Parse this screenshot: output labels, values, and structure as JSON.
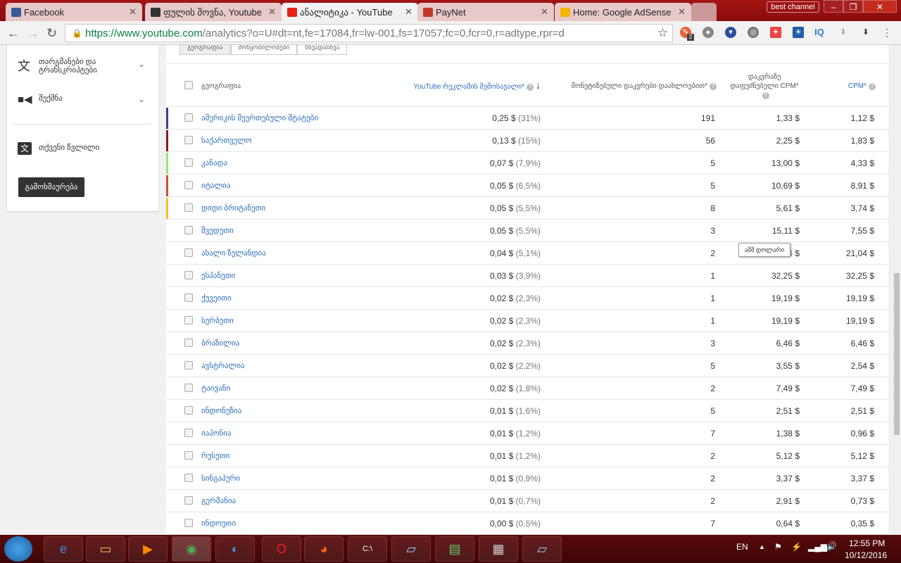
{
  "browser": {
    "tabs": [
      {
        "title": "Facebook",
        "icon": "facebook-icon",
        "color": "#3b5998"
      },
      {
        "title": "ფულის შოვნა, Youtube",
        "icon": "site-logo-icon",
        "color": "#333333"
      },
      {
        "title": "ანალიტიკა - YouTube",
        "icon": "youtube-icon",
        "color": "#e62117",
        "active": true
      },
      {
        "title": "PayNet",
        "icon": "paynet-icon",
        "color": "#c0392b"
      },
      {
        "title": "Home: Google AdSense",
        "icon": "adsense-icon",
        "color": "#f4b400"
      }
    ],
    "profile": "best channel",
    "url_host": "https://www.youtube.com",
    "url_path": "/analytics?o=U#dt=nt,fe=17084,fr=lw-001,fs=17057;fc=0,fcr=0,r=adtype,rpr=d",
    "extension_badge": "2",
    "extension_iq": "IQ"
  },
  "sidebar": {
    "items": [
      {
        "label": "თარგმანები და ტრანსკრიპტები",
        "icon": "translate-icon"
      },
      {
        "label": "შექმნა",
        "icon": "video-camera-icon"
      },
      {
        "label": "თქვენი წვლილი",
        "icon": "translate-box-icon"
      }
    ],
    "send_button": "გამოხმაურება"
  },
  "subtabs": [
    "გეოგრაფია",
    "მოწყობილობები",
    "სხვადასხვა"
  ],
  "table": {
    "headers": {
      "geo": "გეოგრაფია",
      "revenue": "YouTube რეკლამის შემოსავალი*",
      "clicks": "მონეტიზებული დაკვრები დაახლოებით*",
      "playback_cpm": "დაკვრაზე დაფუძნებული CPM*",
      "cpm": "CPM*"
    },
    "sort": "descending",
    "rows": [
      {
        "geo": "ამერიკის შეერთებული შტატები",
        "rev": "0,25 $",
        "pct": "(31%)",
        "plays": "191",
        "pcpm": "1,33 $",
        "cpm": "1,12 $",
        "color": "#3c3c8c"
      },
      {
        "geo": "საქართველო",
        "rev": "0,13 $",
        "pct": "(15%)",
        "plays": "56",
        "pcpm": "2,25 $",
        "cpm": "1,83 $",
        "color": "#8b1a1a"
      },
      {
        "geo": "კანადა",
        "rev": "0,07 $",
        "pct": "(7,9%)",
        "plays": "5",
        "pcpm": "13,00 $",
        "cpm": "4,33 $",
        "color": "#9be07a"
      },
      {
        "geo": "იტალია",
        "rev": "0,05 $",
        "pct": "(6,5%)",
        "plays": "5",
        "pcpm": "10,69 $",
        "cpm": "8,91 $",
        "color": "#c9503a"
      },
      {
        "geo": "დიდი ბრიტანეთი",
        "rev": "0,05 $",
        "pct": "(5,5%)",
        "plays": "8",
        "pcpm": "5,61 $",
        "cpm": "3,74 $",
        "color": "#f2c12e"
      },
      {
        "geo": "შვედეთი",
        "rev": "0,05 $",
        "pct": "(5,5%)",
        "plays": "3",
        "pcpm": "15,11 $",
        "cpm": "7,55 $"
      },
      {
        "geo": "ახალი ზელანდია",
        "rev": "0,04 $",
        "pct": "(5,1%)",
        "plays": "2",
        "pcpm": "4 $",
        "cpm": "21,04 $"
      },
      {
        "geo": "ესპანეთი",
        "rev": "0,03 $",
        "pct": "(3,9%)",
        "plays": "1",
        "pcpm": "32,25 $",
        "cpm": "32,25 $"
      },
      {
        "geo": "ქუვეითი",
        "rev": "0,02 $",
        "pct": "(2,3%)",
        "plays": "1",
        "pcpm": "19,19 $",
        "cpm": "19,19 $"
      },
      {
        "geo": "სერბეთი",
        "rev": "0,02 $",
        "pct": "(2,3%)",
        "plays": "1",
        "pcpm": "19,19 $",
        "cpm": "19,19 $"
      },
      {
        "geo": "ბრაზილია",
        "rev": "0,02 $",
        "pct": "(2,3%)",
        "plays": "3",
        "pcpm": "6,46 $",
        "cpm": "6,46 $"
      },
      {
        "geo": "ავსტრალია",
        "rev": "0,02 $",
        "pct": "(2,2%)",
        "plays": "5",
        "pcpm": "3,55 $",
        "cpm": "2,54 $"
      },
      {
        "geo": "ტაივანი",
        "rev": "0,02 $",
        "pct": "(1,8%)",
        "plays": "2",
        "pcpm": "7,49 $",
        "cpm": "7,49 $"
      },
      {
        "geo": "ინდონეზია",
        "rev": "0,01 $",
        "pct": "(1,6%)",
        "plays": "5",
        "pcpm": "2,51 $",
        "cpm": "2,51 $"
      },
      {
        "geo": "იაპონია",
        "rev": "0,01 $",
        "pct": "(1,2%)",
        "plays": "7",
        "pcpm": "1,38 $",
        "cpm": "0,96 $"
      },
      {
        "geo": "რუსეთი",
        "rev": "0,01 $",
        "pct": "(1,2%)",
        "plays": "2",
        "pcpm": "5,12 $",
        "cpm": "5,12 $"
      },
      {
        "geo": "სინგაპური",
        "rev": "0,01 $",
        "pct": "(0,9%)",
        "plays": "2",
        "pcpm": "3,37 $",
        "cpm": "3,37 $"
      },
      {
        "geo": "გერმანია",
        "rev": "0,01 $",
        "pct": "(0,7%)",
        "plays": "2",
        "pcpm": "2,91 $",
        "cpm": "0,73 $"
      },
      {
        "geo": "ინდოეთი",
        "rev": "0,00 $",
        "pct": "(0,5%)",
        "plays": "7",
        "pcpm": "0,64 $",
        "cpm": "0,35 $"
      }
    ],
    "tooltip": "აშშ დოლარი"
  },
  "taskbar": {
    "lang": "EN",
    "time": "12:55 PM",
    "date": "10/12/2016"
  }
}
